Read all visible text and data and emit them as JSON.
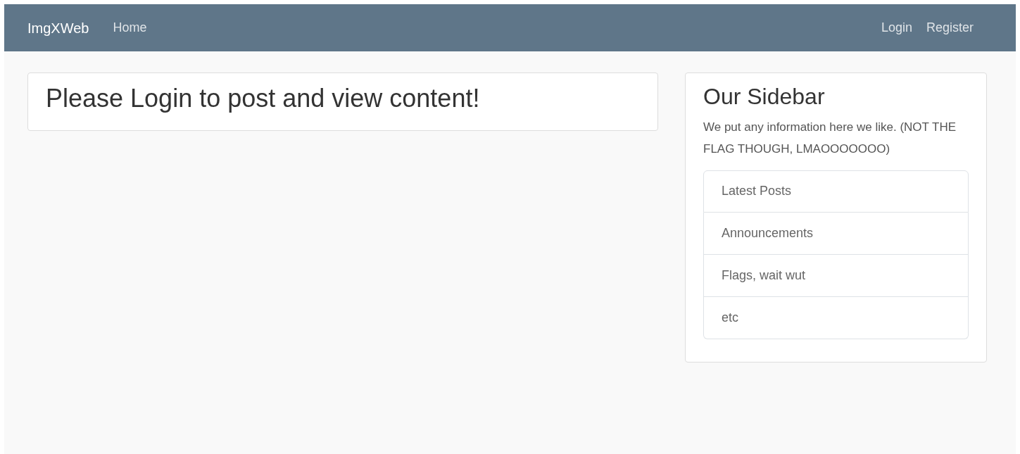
{
  "navbar": {
    "brand": "ImgXWeb",
    "left_links": [
      "Home"
    ],
    "right_links": [
      "Login",
      "Register"
    ]
  },
  "main": {
    "heading": "Please Login to post and view content!"
  },
  "sidebar": {
    "title": "Our Sidebar",
    "text": "We put any information here we like. (NOT THE FLAG THOUGH, LMAOOOOOOO)",
    "items": [
      "Latest Posts",
      "Announcements",
      "Flags, wait wut",
      "etc"
    ]
  }
}
